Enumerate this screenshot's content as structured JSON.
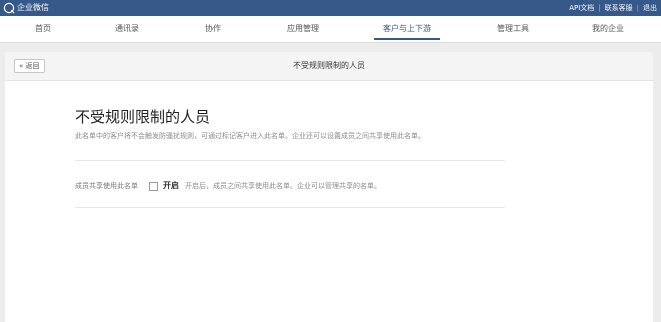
{
  "topbar": {
    "brand": "企业微信",
    "links": [
      "API文档",
      "联系客服",
      "退出"
    ]
  },
  "nav": {
    "items": [
      "首页",
      "通讯录",
      "协作",
      "应用管理",
      "客户与上下游",
      "管理工具",
      "我的企业"
    ],
    "active": "客户与上下游"
  },
  "subheader": {
    "back": "« 返回",
    "title": "不受规则限制的人员"
  },
  "main": {
    "title": "不受规则限制的人员",
    "description": "此名单中的客户将不会触发防骚扰规则，可通过标记客户进入此名单。企业还可以设置成员之间共享使用此名单。",
    "setting": {
      "label": "成员共享使用此名单",
      "toggle_label": "开启",
      "checked": false,
      "hint": "开启后，成员之间共享使用此名单。企业可以管理共享的名单。"
    }
  },
  "colors": {
    "topbar": "#36598a",
    "accent": "#36598a",
    "page_bg": "#ececec"
  },
  "icons": {
    "brand": "wecom-logo-icon"
  }
}
